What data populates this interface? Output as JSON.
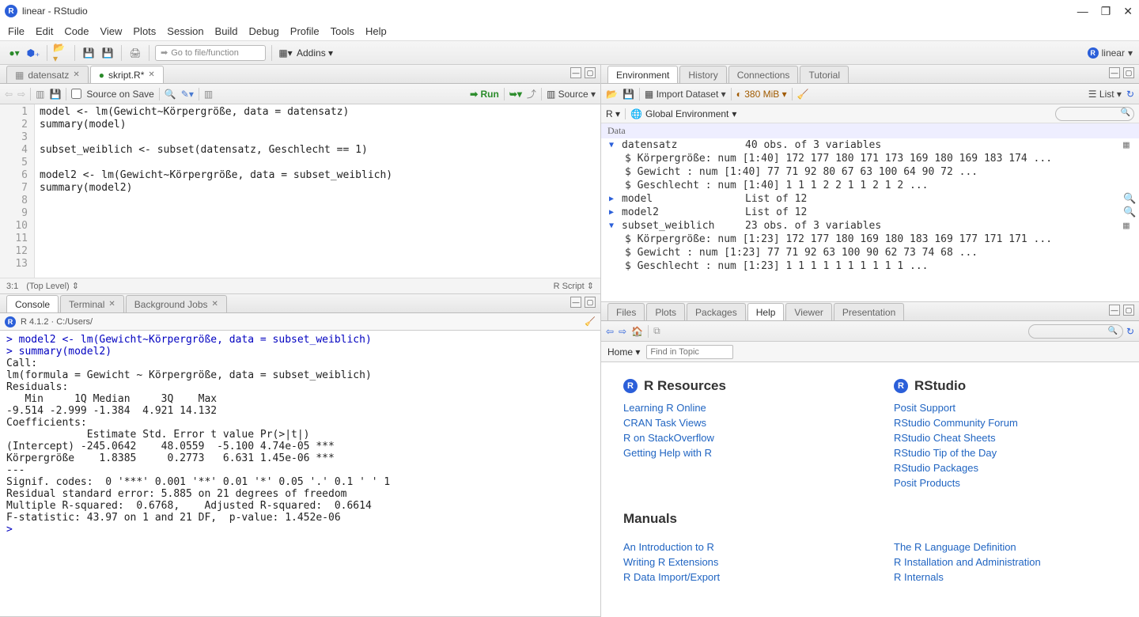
{
  "window": {
    "title": "linear - RStudio"
  },
  "menu": [
    "File",
    "Edit",
    "Code",
    "View",
    "Plots",
    "Session",
    "Build",
    "Debug",
    "Profile",
    "Tools",
    "Help"
  ],
  "toolbar": {
    "goto": "Go to file/function",
    "addins": "Addins",
    "project": "linear"
  },
  "source": {
    "tabs": [
      {
        "icon": "table",
        "label": "datensatz"
      },
      {
        "icon": "r",
        "label": "skript.R*"
      }
    ],
    "save_on_save": "Source on Save",
    "run": "Run",
    "source_btn": "Source",
    "code_lines": [
      "model <- lm(Gewicht~Körpergröße, data = datensatz)",
      "summary(model)",
      "",
      "subset_weiblich <- subset(datensatz, Geschlecht == 1)",
      "",
      "model2 <- lm(Gewicht~Körpergröße, data = subset_weiblich)",
      "summary(model2)",
      "",
      "",
      "",
      "",
      "",
      ""
    ],
    "status_pos": "3:1",
    "status_scope": "(Top Level)",
    "status_type": "R Script"
  },
  "console": {
    "tabs": [
      "Console",
      "Terminal",
      "Background Jobs"
    ],
    "version": "R 4.1.2 · C:/Users/",
    "output": "> model2 <- lm(Gewicht~Körpergröße, data = subset_weiblich)\n> summary(model2)\n\nCall:\nlm(formula = Gewicht ~ Körpergröße, data = subset_weiblich)\n\nResiduals:\n   Min     1Q Median     3Q    Max \n-9.514 -2.999 -1.384  4.921 14.132 \n\nCoefficients:\n             Estimate Std. Error t value Pr(>|t|)    \n(Intercept) -245.0642    48.0559  -5.100 4.74e-05 ***\nKörpergröße    1.8385     0.2773   6.631 1.45e-06 ***\n---\nSignif. codes:  0 '***' 0.001 '**' 0.01 '*' 0.05 '.' 0.1 ' ' 1\n\nResidual standard error: 5.885 on 21 degrees of freedom\nMultiple R-squared:  0.6768,\tAdjusted R-squared:  0.6614 \nF-statistic: 43.97 on 1 and 21 DF,  p-value: 1.452e-06\n\n> "
  },
  "env": {
    "tabs": [
      "Environment",
      "History",
      "Connections",
      "Tutorial"
    ],
    "import": "Import Dataset",
    "mem": "380 MiB",
    "view_mode": "List",
    "scope": "Global Environment",
    "r_label": "R",
    "section": "Data",
    "rows": [
      {
        "type": "expand",
        "name": "datensatz",
        "val": "40 obs. of  3 variables",
        "action": "table"
      },
      {
        "type": "sub",
        "name": "$ Körpergröße: num [1:40] 172 177 180 171 173 169 180 169 183 174 ..."
      },
      {
        "type": "sub",
        "name": "$ Gewicht    : num [1:40] 77 71 92 80 67 63 100 64 90 72 ..."
      },
      {
        "type": "sub",
        "name": "$ Geschlecht : num [1:40] 1 1 1 2 2 1 1 2 1 2 ..."
      },
      {
        "type": "obj",
        "name": "model",
        "val": "List of  12",
        "action": "lens"
      },
      {
        "type": "obj",
        "name": "model2",
        "val": "List of  12",
        "action": "lens"
      },
      {
        "type": "expand",
        "name": "subset_weiblich",
        "val": "23 obs. of  3 variables",
        "action": "table"
      },
      {
        "type": "sub",
        "name": "$ Körpergröße: num [1:23] 172 177 180 169 180 183 169 177 171 171 ..."
      },
      {
        "type": "sub",
        "name": "$ Gewicht    : num [1:23] 77 71 92 63 100 90 62 73 74 68 ..."
      },
      {
        "type": "sub",
        "name": "$ Geschlecht : num [1:23] 1 1 1 1 1 1 1 1 1 1 ..."
      }
    ]
  },
  "help": {
    "tabs": [
      "Files",
      "Plots",
      "Packages",
      "Help",
      "Viewer",
      "Presentation"
    ],
    "home": "Home",
    "find_placeholder": "Find in Topic",
    "sections": {
      "resources": {
        "title": "R Resources",
        "links": [
          "Learning R Online",
          "CRAN Task Views",
          "R on StackOverflow",
          "Getting Help with R"
        ]
      },
      "rstudio": {
        "title": "RStudio",
        "links": [
          "Posit Support",
          "RStudio Community Forum",
          "RStudio Cheat Sheets",
          "RStudio Tip of the Day",
          "RStudio Packages",
          "Posit Products"
        ]
      },
      "manuals": {
        "title": "Manuals"
      },
      "manuals_l": [
        "An Introduction to R",
        "Writing R Extensions",
        "R Data Import/Export"
      ],
      "manuals_r": [
        "The R Language Definition",
        "R Installation and Administration",
        "R Internals"
      ]
    }
  }
}
